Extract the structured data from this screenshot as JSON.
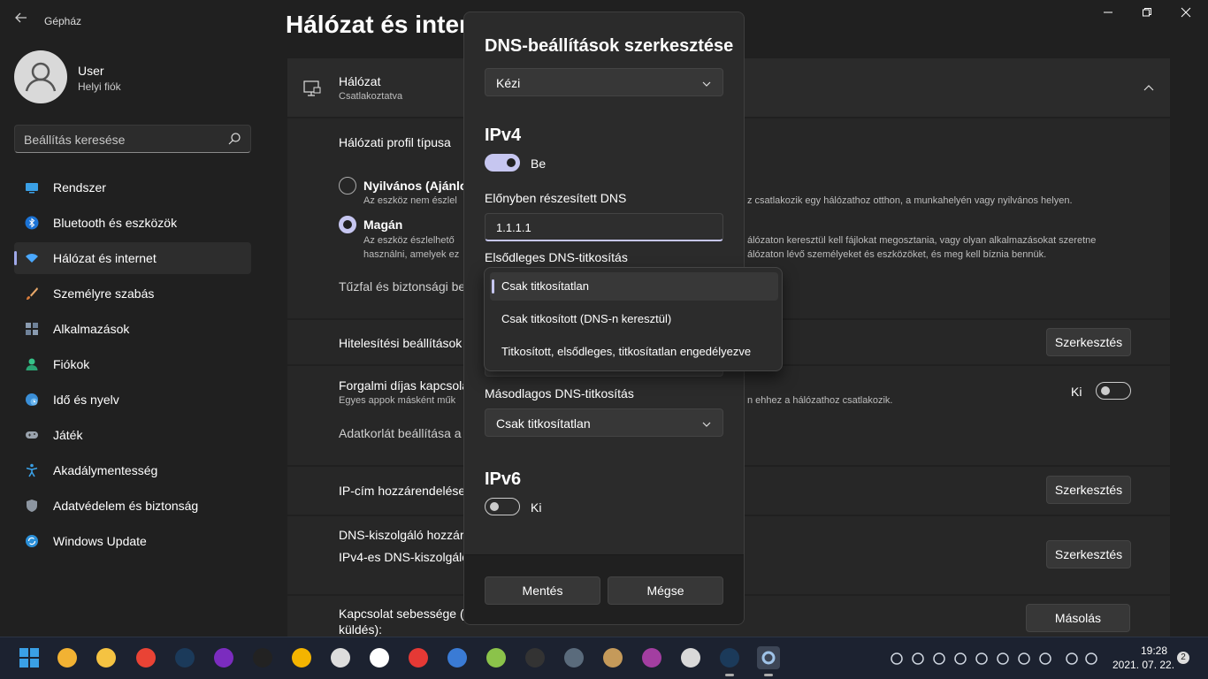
{
  "window": {
    "app_title": "Gépház",
    "page_title": "Hálózat és internet"
  },
  "user": {
    "name": "User",
    "account_type": "Helyi fiók"
  },
  "search": {
    "placeholder": "Beállítás keresése"
  },
  "sidebar": {
    "items": [
      {
        "label": "Rendszer",
        "icon": "system-icon",
        "active": false
      },
      {
        "label": "Bluetooth és eszközök",
        "icon": "bluetooth-icon",
        "active": false
      },
      {
        "label": "Hálózat és internet",
        "icon": "wifi-icon",
        "active": true
      },
      {
        "label": "Személyre szabás",
        "icon": "brush-icon",
        "active": false
      },
      {
        "label": "Alkalmazások",
        "icon": "apps-icon",
        "active": false
      },
      {
        "label": "Fiókok",
        "icon": "person-icon",
        "active": false
      },
      {
        "label": "Idő és nyelv",
        "icon": "globe-clock-icon",
        "active": false
      },
      {
        "label": "Játék",
        "icon": "gamepad-icon",
        "active": false
      },
      {
        "label": "Akadálymentesség",
        "icon": "accessibility-icon",
        "active": false
      },
      {
        "label": "Adatvédelem és biztonság",
        "icon": "shield-icon",
        "active": false
      },
      {
        "label": "Windows Update",
        "icon": "update-icon",
        "active": false
      }
    ]
  },
  "main": {
    "network": {
      "title": "Hálózat",
      "status": "Csatlakoztatva"
    },
    "profile": {
      "heading": "Hálózati profil típusa",
      "public_label": "Nyilvános (Ajánlot",
      "public_desc": "Az eszköz nem észlel",
      "public_desc_right": "z csatlakozik egy hálózathoz otthon, a munkahelyén vagy nyilvános helyen.",
      "private_label": "Magán",
      "private_desc_1": "Az eszköz észlelhető",
      "private_desc_1_right": "álózaton keresztül kell fájlokat megosztania, vagy olyan alkalmazásokat szeretne",
      "private_desc_2": "használni, amelyek ez",
      "private_desc_2_right": "álózaton lévő személyeket és eszközöket, és meg kell bíznia bennük.",
      "firewall": "Tűzfal és biztonsági be"
    },
    "auth": {
      "label": "Hitelesítési beállítások",
      "button": "Szerkesztés"
    },
    "metered": {
      "label": "Forgalmi díjas kapcsola",
      "desc": "Egyes appok másként műk",
      "desc_right": "n ehhez a hálózathoz csatlakozik.",
      "toggle_label": "Ki",
      "data_limit": "Adatkorlát beállítása a"
    },
    "ip": {
      "label": "IP-cím hozzárendelése:",
      "button": "Szerkesztés"
    },
    "dns": {
      "label": "DNS-kiszolgáló hozzár",
      "sub": "IPv4-es DNS-kiszolgáló",
      "button": "Szerkesztés"
    },
    "speed": {
      "label": "Kapcsolat sebessége (fo",
      "sub": "küldés):",
      "button": "Másolás"
    }
  },
  "dialog": {
    "title": "DNS-beállítások szerkesztése",
    "mode": "Kézi",
    "ipv4": {
      "heading": "IPv4",
      "toggle_label": "Be",
      "toggle_on": true,
      "preferred_label": "Előnyben részesített DNS",
      "preferred_value": "1.1.1.1",
      "primary_encryption_label": "Elsődleges DNS-titkosítás",
      "secondary_encryption_label": "Másodlagos DNS-titkosítás",
      "secondary_encryption_value": "Csak titkosítatlan"
    },
    "ipv6": {
      "heading": "IPv6",
      "toggle_label": "Ki",
      "toggle_on": false
    },
    "save": "Mentés",
    "cancel": "Mégse"
  },
  "dropdown": {
    "options": [
      "Csak titkosítatlan",
      "Csak titkosított (DNS-n keresztül)",
      "Titkosított, elsődleges, titkosítatlan engedélyezve"
    ],
    "selected_index": 0
  },
  "taskbar": {
    "apps": [
      "start-icon",
      "store-icon",
      "explorer-icon",
      "chrome-icon",
      "steam-icon",
      "circle-app-icon",
      "epic-games-icon",
      "rockstar-icon",
      "ubisoft-icon",
      "xbox-icon",
      "ea-icon",
      "bluestacks-icon",
      "android-icon",
      "terminal-icon",
      "calculator-icon",
      "library-icon",
      "paint-icon",
      "media-icon",
      "steam-icon-2",
      "settings-icon"
    ],
    "time": "19:28",
    "date": "2021. 07. 22.",
    "notifications": "2"
  },
  "colors": {
    "accent": "#c6c6f0",
    "background": "#202020",
    "card": "#2b2b2b"
  }
}
